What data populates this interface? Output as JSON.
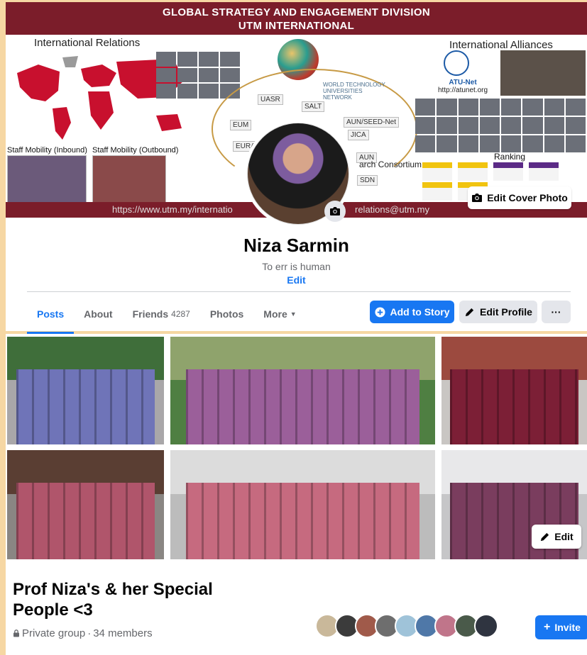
{
  "cover": {
    "banner_line1": "GLOBAL STRATEGY AND ENGAGEMENT DIVISION",
    "banner_line2": "UTM INTERNATIONAL",
    "international_relations": "International Relations",
    "international_alliances": "International Alliances",
    "staff_mobility_inbound": "Staff Mobility (Inbound)",
    "staff_mobility_outbound": "Staff Mobility (Outbound)",
    "atu_net": "ATU-Net",
    "atu_url": "http://atunet.org",
    "ranking": "Ranking",
    "partners": [
      "UASR",
      "SALT",
      "EUM",
      "EURAS",
      "JICA",
      "AUN/SEED-Net",
      "AUN",
      "SDN"
    ],
    "wtun": "WORLD TECHNOLOGY UNIVERSITIES NETWORK",
    "research_consortium": "arch Consortium",
    "footer_url": "https://www.utm.my/internatio",
    "footer_mail": "relations@utm.my",
    "edit_cover_label": "Edit Cover Photo",
    "brand_color": "#7b1d2a"
  },
  "profile": {
    "name": "Niza Sarmin",
    "bio": "To err is human",
    "bio_edit": "Edit"
  },
  "tabs": [
    {
      "label": "Posts",
      "active": true
    },
    {
      "label": "About"
    },
    {
      "label": "Friends",
      "count": "4287"
    },
    {
      "label": "Photos"
    },
    {
      "label": "More"
    }
  ],
  "actions": {
    "add_to_story": "Add to Story",
    "edit_profile": "Edit Profile",
    "more_dots": "···"
  },
  "group": {
    "edit_label": "Edit",
    "title": "Prof Niza's & her Special People <3",
    "privacy": "Private group",
    "separator": " · ",
    "members": "34 members",
    "invite": "Invite",
    "invite_plus": "+"
  },
  "colors": {
    "accent": "#1877f2",
    "page_bg": "#f6d7a3"
  }
}
